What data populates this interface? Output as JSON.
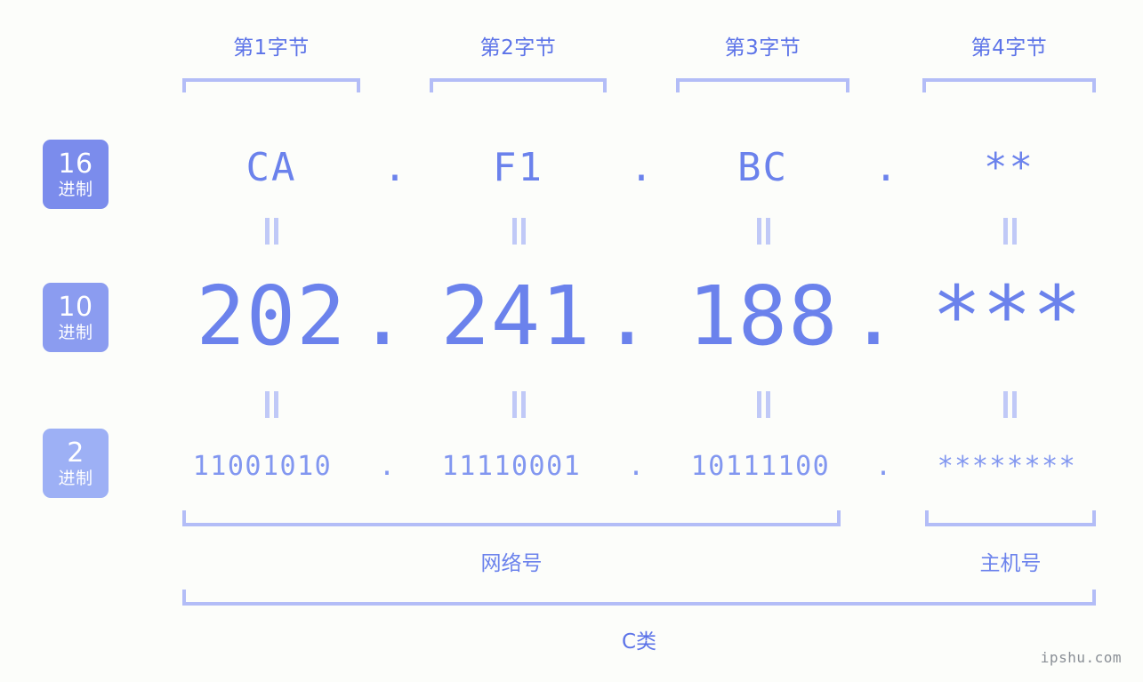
{
  "background_color": "#fcfdfa",
  "accent_color": "#5c73e8",
  "value_color": "#6b82ec",
  "bracket_color": "#b3bdf7",
  "byte_headers": [
    {
      "label": "第1字节"
    },
    {
      "label": "第2字节"
    },
    {
      "label": "第3字节"
    },
    {
      "label": "第4字节"
    }
  ],
  "bases": [
    {
      "num": "16",
      "suffix": "进制",
      "color": "#7b8cec"
    },
    {
      "num": "10",
      "suffix": "进制",
      "color": "#8b9cf0"
    },
    {
      "num": "2",
      "suffix": "进制",
      "color": "#9db0f5"
    }
  ],
  "rows": {
    "hex": {
      "octets": [
        "CA",
        "F1",
        "BC",
        "**"
      ],
      "separator": "."
    },
    "decimal": {
      "octets": [
        "202",
        "241",
        "188",
        "***"
      ],
      "separator": "."
    },
    "binary": {
      "octets": [
        "11001010",
        "11110001",
        "10111100",
        "********"
      ],
      "separator": "."
    }
  },
  "equals_symbol": "=",
  "sections": {
    "network": "网络号",
    "host": "主机号",
    "class": "C类"
  },
  "watermark": "ipshu.com"
}
